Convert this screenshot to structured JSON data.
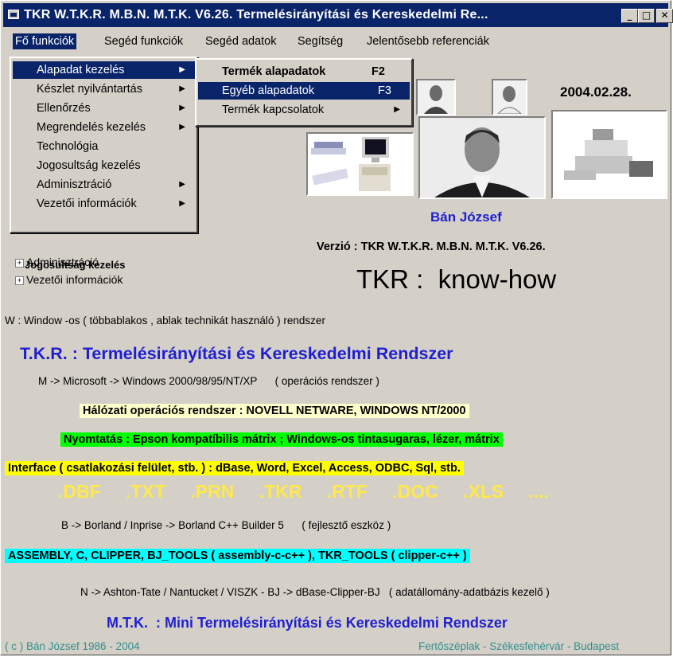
{
  "window": {
    "title": "TKR W.T.K.R. M.B.N. M.T.K. V6.26. Termelésirányítási és Kereskedelmi Re...",
    "minimize": "_",
    "maximize": "□",
    "close": "✕"
  },
  "menubar": [
    {
      "label": "Fő funkciók"
    },
    {
      "label": "Segéd funkciók"
    },
    {
      "label": "Segéd adatok"
    },
    {
      "label": "Segítség"
    },
    {
      "label": "Jelentősebb referenciák"
    }
  ],
  "fo_menu": [
    {
      "label": "Alapadat kezelés",
      "submenu": true
    },
    {
      "label": "Készlet nyilvántartás",
      "submenu": true
    },
    {
      "label": "Ellenőrzés",
      "submenu": true
    },
    {
      "label": "Megrendelés kezelés",
      "submenu": true
    },
    {
      "label": "Technológia",
      "submenu": false
    },
    {
      "label": "Jogosultság kezelés",
      "submenu": false
    },
    {
      "label": "Adminisztráció",
      "submenu": true
    },
    {
      "label": "Vezetői információk",
      "submenu": true
    }
  ],
  "alapadat_menu": [
    {
      "label": "Termék alapadatok",
      "shortcut": "F2"
    },
    {
      "label": "Egyéb alapadatok",
      "shortcut": "F3"
    },
    {
      "label": "Termék kapcsolatok",
      "shortcut": ""
    }
  ],
  "tree": [
    {
      "label": "Jogosultság kezelés"
    },
    {
      "label": "Adminisztráció"
    },
    {
      "label": "Vezetői információk"
    }
  ],
  "date": "2004.02.28.",
  "author": "Bán József",
  "version": "Verzió : TKR W.T.K.R. M.B.N. M.T.K. V6.26.",
  "knowhow": "TKR :  know-how",
  "lines": {
    "w": "W : Window -os ( többablakos , ablak technikát használó ) rendszer",
    "tkr": "T.K.R. : Termelésirányítási és Kereskedelmi Rendszer",
    "m": "M -> Microsoft -> Windows 2000/98/95/NT/XP      ( operációs rendszer )",
    "halozat": "Hálózati operációs rendszer : NOVELL NETWARE, WINDOWS NT/2000",
    "nyomtatas": "Nyomtatás : Epson kompatíbilis mátrix ;  Windows-os tintasugaras, lézer, mátrix",
    "interface": "Interface ( csatlakozási felület, stb. )  : dBase, Word, Excel, Access, ODBC, Sql, stb.",
    "b": "B -> Borland / Inprise -> Borland C++ Builder 5      ( fejlesztő eszköz )",
    "assembly": "ASSEMBLY, C, CLIPPER, BJ_TOOLS ( assembly-c-c++ ), TKR_TOOLS ( clipper-c++ )",
    "n": "N -> Ashton-Tate / Nantucket / VISZK - BJ -> dBase-Clipper-BJ   ( adatállomány-adatbázis kezelő )",
    "mtk": "M.T.K.  : Mini Termelésirányítási és Kereskedelmi Rendszer",
    "copyright": "( c ) Bán József 1986 - 2004",
    "places": "Fertőszéplak - Székesfehérvár - Budapest"
  },
  "extensions": [
    ".DBF",
    ".TXT",
    ".PRN",
    ".TKR",
    ".RTF",
    ".DOC",
    ".XLS",
    "...."
  ],
  "colors": {
    "titlebar": "#0a246a",
    "blue_text": "#1f1fd0",
    "yellow_text": "#ffe84a",
    "halozat_bg": "#ffffcc",
    "nyomtatas_bg": "#00ff00",
    "interface_bg": "#ffff00",
    "assembly_bg": "#00ffff"
  }
}
